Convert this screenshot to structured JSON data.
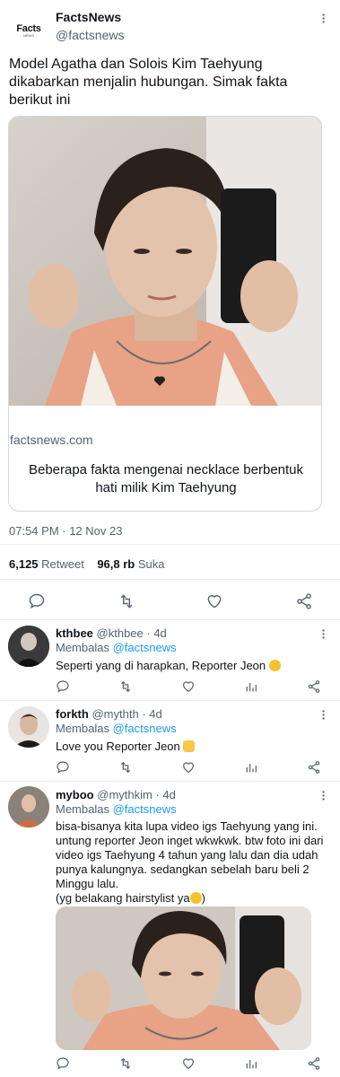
{
  "tweet": {
    "author_name": "FactsNews",
    "author_handle": "@factsnews",
    "avatar_text": "Facts",
    "avatar_subtext": "NEWS",
    "text": "Model Agatha dan Solois Kim Taehyung dikabarkan menjalin hubungan. Simak fakta berikut ini",
    "card": {
      "domain": "factsnews.com",
      "title": "Beberapa fakta mengenai necklace berbentuk hati milik Kim Taehyung"
    },
    "timestamp": "07:54 PM · 12 Nov 23",
    "retweet_count": "6,125",
    "retweet_label": "Retweet",
    "like_count": "96,8 rb",
    "like_label": "Suka"
  },
  "replies": [
    {
      "name": "kthbee",
      "handle": "@kthbee",
      "age": "· 4d",
      "replying_prefix": "Membalas",
      "replying_to": "@factsnews",
      "text": "Seperti yang di harapkan, Reporter Jeon",
      "emoji": "heart-eyes-emoji"
    },
    {
      "name": "forkth",
      "handle": "@mythth",
      "age": "· 4d",
      "replying_prefix": "Membalas",
      "replying_to": "@factsnews",
      "text": "Love you Reporter Jeon",
      "emoji": "pinch-hand-emoji"
    },
    {
      "name": "myboo",
      "handle": "@mythkim",
      "age": "· 4d",
      "replying_prefix": "Membalas",
      "replying_to": "@factsnews",
      "text_lines": [
        "bisa-bisanya kita lupa video igs Taehyung yang ini.",
        "untung reporter Jeon inget wkwkwk. btw foto ini dari",
        "video igs Taehyung 4 tahun yang lalu dan dia udah",
        "punya kalungnya. sedangkan sebelah baru beli 2",
        "Minggu lalu.",
        "(yg belakang hairstylist ya"
      ],
      "emoji": "grin-emoji"
    }
  ],
  "icons": [
    "reply-icon",
    "retweet-icon",
    "like-icon",
    "share-icon",
    "views-icon",
    "more-icon"
  ],
  "colors": {
    "link": "#1d9bf0",
    "muted": "#536471",
    "text": "#0f1419",
    "divider": "#e7ecf0"
  }
}
